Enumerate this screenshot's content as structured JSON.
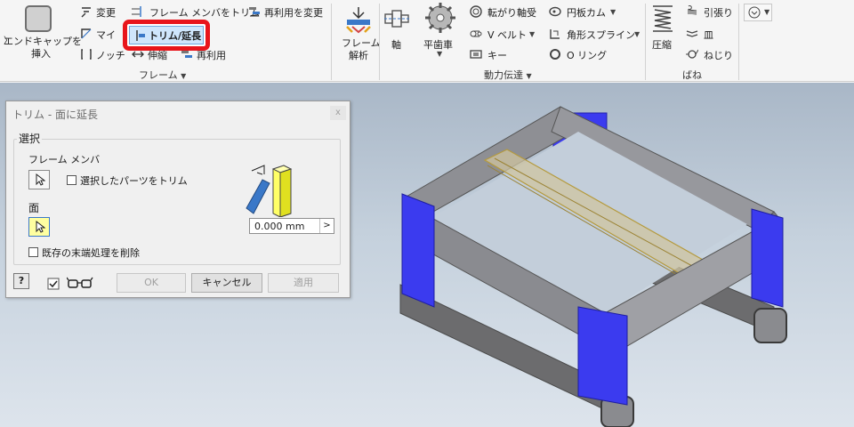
{
  "ribbon": {
    "insert_end_cap": {
      "line1": "エンドキャップを",
      "line2": "挿入"
    },
    "change": "変更",
    "miter": "マイ",
    "notch": "ノッチ",
    "trim_to_member": "フレーム メンバをトリム",
    "trim_extend": "トリム/延長",
    "lengthen": "伸縮",
    "reuse": "再利用",
    "change_reuse": "再利用を変更",
    "frame_group": "フレーム",
    "frame_analysis": {
      "line1": "フレーム",
      "line2": "解析"
    },
    "shaft": "軸",
    "spur_gear": "平歯車",
    "bearing": "転がり軸受",
    "vbelt": "V ベルト",
    "key": "キー",
    "disc_cam": "円板カム",
    "spline": "角形スプライン",
    "oring": "O リング",
    "power_group": "動力伝達",
    "compression": "圧縮",
    "extension": "引張り",
    "belleville": "皿",
    "torsion": "ねじり",
    "spring_group": "ばね",
    "highlight_color": "#e8151b"
  },
  "dialog": {
    "title": "トリム - 面に延長",
    "group_caption": "選択",
    "frame_members_label": "フレーム メンバ",
    "trim_selected_label": "選択したパーツをトリム",
    "face_label": "面",
    "remove_end_treatment_label": "既存の末端処理を削除",
    "distance_value": "0.000 mm",
    "ok_label": "OK",
    "cancel_label": "キャンセル",
    "apply_label": "適用",
    "help_icon": "?",
    "close_icon": "x"
  },
  "model": {
    "frame_color": "#8c8d92",
    "leg_color": "#3333ee",
    "highlight_color": "#c8b56a"
  }
}
